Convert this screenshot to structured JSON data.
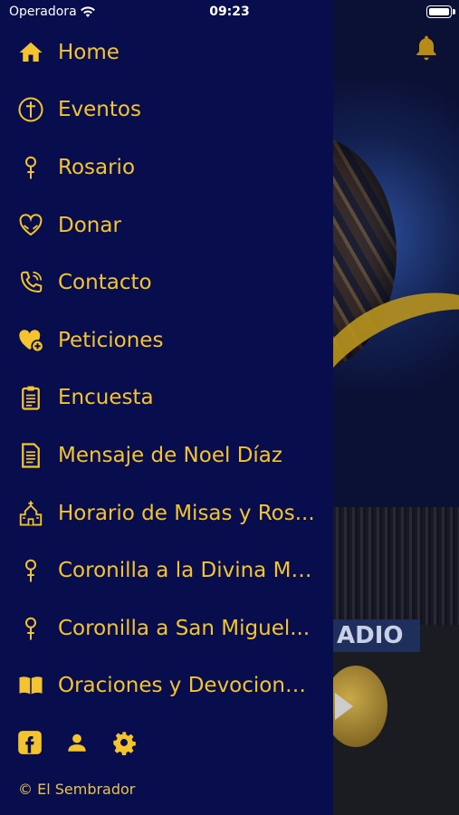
{
  "status_bar": {
    "carrier": "Operadora",
    "time": "09:23"
  },
  "menu": {
    "items": [
      {
        "label": "Home",
        "icon": "home-icon"
      },
      {
        "label": "Eventos",
        "icon": "cross-circle-icon"
      },
      {
        "label": "Rosario",
        "icon": "rosary-icon"
      },
      {
        "label": "Donar",
        "icon": "heart-hands-icon"
      },
      {
        "label": "Contacto",
        "icon": "phone-icon"
      },
      {
        "label": "Peticiones",
        "icon": "heart-plus-icon"
      },
      {
        "label": "Encuesta",
        "icon": "clipboard-icon"
      },
      {
        "label": "Mensaje de Noel Díaz",
        "icon": "document-icon"
      },
      {
        "label": "Horario de Misas y Ros...",
        "icon": "church-icon"
      },
      {
        "label": "Coronilla a la Divina Mi...",
        "icon": "rosary-icon"
      },
      {
        "label": "Coronilla a San Miguel...",
        "icon": "rosary-icon"
      },
      {
        "label": "Oraciones y Devociona...",
        "icon": "book-icon"
      }
    ]
  },
  "social": [
    "facebook-icon",
    "user-icon",
    "gear-icon"
  ],
  "footer": {
    "copyright": "© El Sembrador"
  },
  "background": {
    "radio_label": "ADIO"
  },
  "colors": {
    "drawer_bg": "#080e4d",
    "accent": "#f4c430",
    "backdrop": "#0b1035"
  }
}
